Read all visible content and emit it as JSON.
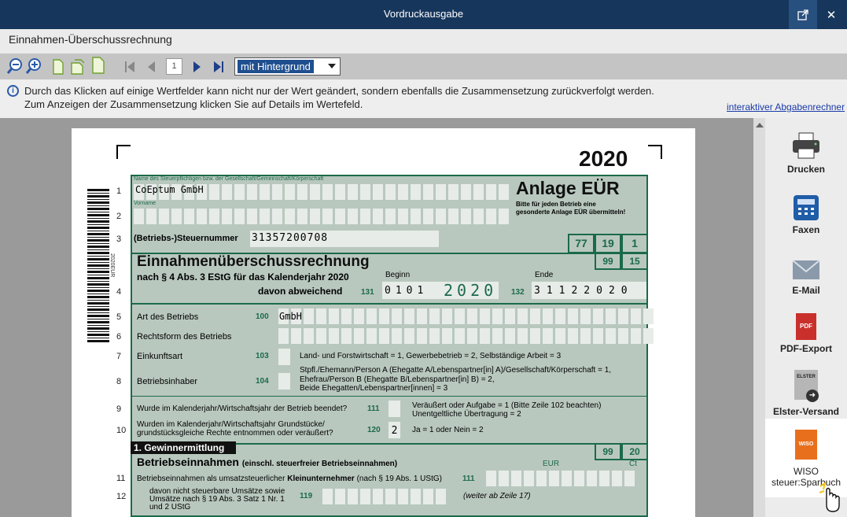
{
  "window": {
    "title": "Vordruckausgabe",
    "popout_icon": "external-window-icon",
    "close_label": "✕"
  },
  "subheader": "Einnahmen-Überschussrechnung",
  "toolbar": {
    "page_value": "1",
    "background_option": "mit Hintergrund"
  },
  "info": {
    "line1": "Durch das Klicken auf einige Wertfelder kann nicht nur der Wert geändert, sondern ebenfalls die Zusammensetzung zurückverfolgt werden.",
    "line2": "Zum Anzeigen der Zusammensetzung klicken Sie auf Details im Wertefeld.",
    "link": "interaktiver Abgabenrechner"
  },
  "side": {
    "print": "Drucken",
    "fax": "Faxen",
    "email": "E-Mail",
    "pdf": "PDF-Export",
    "elster": "Elster-Versand",
    "wiso_line1": "WISO",
    "wiso_line2": "steuer:Sparbuch",
    "pdf_badge": "PDF",
    "elster_badge": "ELSTER",
    "wiso_badge": "WISO"
  },
  "form": {
    "year": "2020",
    "name_label": "Name des Steuerpflichtigen bzw. der Gesellschaft/Gemeinschaft/Körperschaft",
    "name_value": "CoEptum GmbH",
    "vorname_label": "Vorname",
    "anlage_title": "Anlage EÜR",
    "anlage_sub1": "Bitte für jeden Betrieb eine",
    "anlage_sub2": "gesonderte Anlage EÜR übermitteln!",
    "steuernummer_label": "(Betriebs-)Steuernummer",
    "steuernummer_value": "31357200708",
    "code_77": "77",
    "code_19": "19",
    "code_1": "1",
    "code_99a": "99",
    "code_15": "15",
    "main_title": "Einnahmenüberschussrechnung",
    "main_sub": "nach § 4 Abs. 3 EStG für das Kalenderjahr 2020",
    "beginn_label": "Beginn",
    "ende_label": "Ende",
    "abweichend_label": "davon abweichend",
    "field_131": "131",
    "field_132": "132",
    "beginn_value": "0101",
    "beginn_year": "2020",
    "ende_value": "31122020",
    "art_label": "Art des Betriebs",
    "field_100": "100",
    "art_value": "GmbH",
    "rechtsform_label": "Rechtsform des Betriebs",
    "einkunftsart_label": "Einkunftsart",
    "field_103": "103",
    "einkunftsart_hint": "Land- und Forstwirtschaft = 1, Gewerbebetrieb = 2, Selbständige Arbeit = 3",
    "inhaber_label": "Betriebsinhaber",
    "field_104": "104",
    "inhaber_hint1": "Stpfl./Ehemann/Person A (Ehegatte A/Lebenspartner[in] A)/Gesellschaft/Körperschaft = 1,",
    "inhaber_hint2": "Ehefrau/Person B (Ehegatte B/Lebenspartner[in] B) = 2,",
    "inhaber_hint3": "Beide Ehegatten/Lebenspartner[innen] = 3",
    "beendet_label": "Wurde im Kalenderjahr/Wirtschaftsjahr der Betrieb beendet?",
    "field_111": "111",
    "beendet_hint1": "Veräußert oder Aufgabe       = 1 (Bitte Zeile 102 beachten)",
    "beendet_hint2": "Unentgeltliche Übertragung = 2",
    "grund_label1": "Wurden im Kalenderjahr/Wirtschaftsjahr Grundstücke/",
    "grund_label2": "grundstücksgleiche Rechte entnommen oder veräußert?",
    "field_120": "120",
    "grund_value": "2",
    "grund_hint": "Ja = 1 oder Nein = 2",
    "section_1": "1. Gewinnermittlung",
    "code_99b": "99",
    "code_20": "20",
    "einnahmen_title": "Betriebseinnahmen",
    "einnahmen_sub": "(einschl. steuerfreier Betriebseinnahmen)",
    "eur_label": "EUR",
    "ct_label": "Ct",
    "klein_label_a": "Betriebseinnahmen als umsatzsteuerlicher ",
    "klein_label_b": "Kleinunternehmer",
    "klein_label_c": " (nach § 19 Abs. 1 UStG)",
    "field_111b": "111",
    "davon_label1": "davon nicht steuerbare Umsätze sowie",
    "davon_label2": "Umsätze nach § 19 Abs. 3 Satz 1 Nr. 1",
    "davon_label3": "und 2 UStG",
    "field_119": "119",
    "weiter_hint": "(weiter ab Zeile 17)",
    "side_code": "2020EUR",
    "lines": [
      "1",
      "2",
      "3",
      "4",
      "5",
      "6",
      "7",
      "8",
      "9",
      "10",
      "11",
      "12"
    ]
  }
}
